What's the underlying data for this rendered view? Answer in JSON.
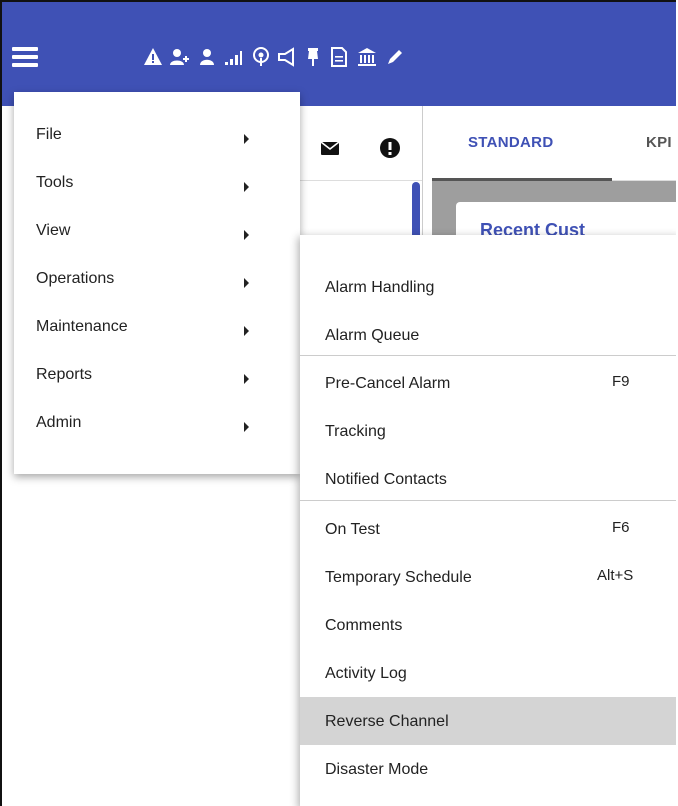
{
  "colors": {
    "header": "#3f51b5",
    "highlight": "#d4d4d4"
  },
  "toolbar": {
    "icons": [
      "hamburger-icon",
      "alert-triangle-icon",
      "add-user-icon",
      "user-icon",
      "signal-icon",
      "podcast-icon",
      "megaphone-icon",
      "pin-icon",
      "document-icon",
      "bank-icon",
      "pencil-icon"
    ]
  },
  "panel": {
    "icons": [
      "envelope-icon",
      "exclamation-icon"
    ]
  },
  "tabs": [
    {
      "label": "STANDARD",
      "active": true
    },
    {
      "label": "KPI",
      "active": false
    }
  ],
  "card": {
    "title": "Recent Cust"
  },
  "menu": {
    "items": [
      {
        "label": "File"
      },
      {
        "label": "Tools"
      },
      {
        "label": "View"
      },
      {
        "label": "Operations"
      },
      {
        "label": "Maintenance"
      },
      {
        "label": "Reports"
      },
      {
        "label": "Admin"
      }
    ]
  },
  "submenu": {
    "items": [
      {
        "label": "Alarm Handling",
        "shortcut": ""
      },
      {
        "label": "Alarm Queue",
        "shortcut": ""
      },
      {
        "label": "Pre-Cancel Alarm",
        "shortcut": "F9"
      },
      {
        "label": "Tracking",
        "shortcut": ""
      },
      {
        "label": "Notified Contacts",
        "shortcut": ""
      },
      {
        "label": "On Test",
        "shortcut": "F6"
      },
      {
        "label": "Temporary Schedule",
        "shortcut": "Alt+S"
      },
      {
        "label": "Comments",
        "shortcut": ""
      },
      {
        "label": "Activity Log",
        "shortcut": ""
      },
      {
        "label": "Reverse Channel",
        "shortcut": "",
        "highlighted": true
      },
      {
        "label": "Disaster Mode",
        "shortcut": ""
      }
    ]
  }
}
